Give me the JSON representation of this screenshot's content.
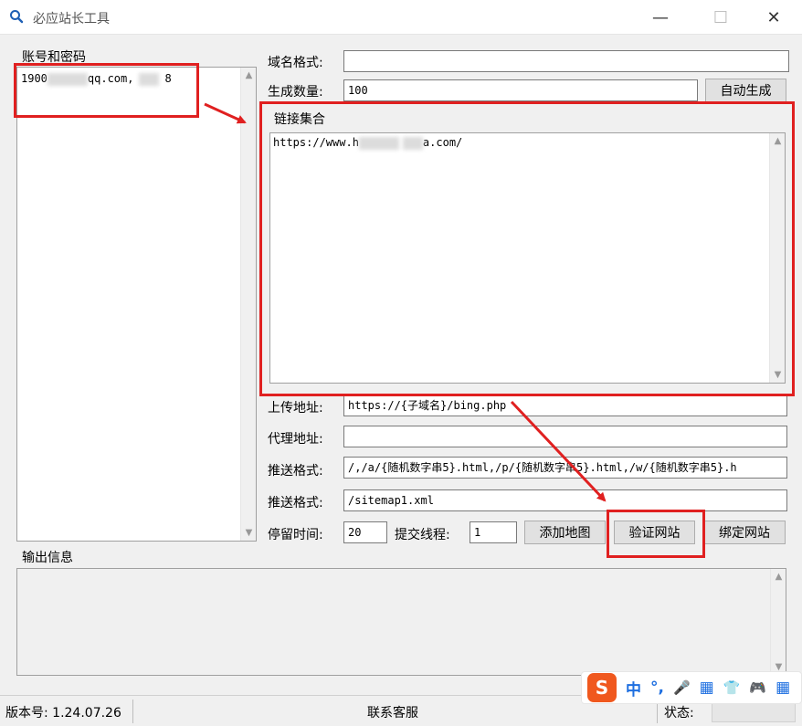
{
  "window": {
    "title": "必应站长工具"
  },
  "accounts": {
    "label": "账号和密码",
    "first_item_a": "1900",
    "first_item_b": "qq.com,",
    "first_item_c": "8"
  },
  "form": {
    "domain_format_label": "域名格式:",
    "domain_format_value": "",
    "gen_count_label": "生成数量:",
    "gen_count_value": "100",
    "auto_generate_button": "自动生成",
    "links_group_label": "链接集合",
    "links_text_a": "https://www.h",
    "links_text_b": "a.com/",
    "upload_addr_label": "上传地址:",
    "upload_addr_value": "https://{子域名}/bing.php",
    "proxy_addr_label": "代理地址:",
    "proxy_addr_value": "",
    "push_format_label_1": "推送格式:",
    "push_format_value_1": "/,/a/{随机数字串5}.html,/p/{随机数字串5}.html,/w/{随机数字串5}.h",
    "push_format_label_2": "推送格式:",
    "push_format_value_2": "/sitemap1.xml",
    "stay_time_label": "停留时间:",
    "stay_time_value": "20",
    "threads_label": "提交线程:",
    "threads_value": "1",
    "add_sitemap_button": "添加地图",
    "verify_site_button": "验证网站",
    "bind_site_button": "绑定网站"
  },
  "output": {
    "label": "输出信息"
  },
  "statusbar": {
    "version": "版本号: 1.24.07.26",
    "contact": "联系客服",
    "status_label": "状态:"
  },
  "ime": {
    "logo": "S",
    "chinese": "中",
    "punct": "°,",
    "mic": "🎤",
    "keyboard": "▦",
    "shirt": "👕",
    "game": "🎮",
    "grid": "▦"
  },
  "colors": {
    "highlight": "#e02020",
    "ime_brand": "#f0581e",
    "ime_blue": "#1e6fe0"
  }
}
